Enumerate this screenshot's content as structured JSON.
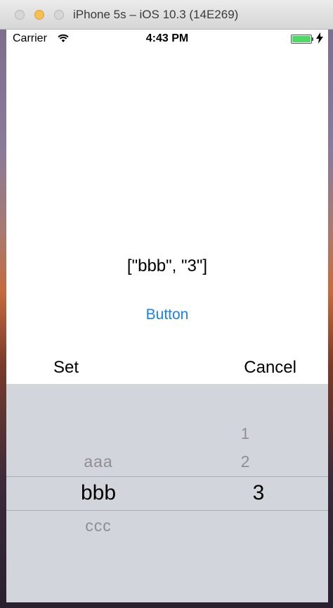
{
  "window": {
    "title": "iPhone 5s – iOS 10.3 (14E269)"
  },
  "status_bar": {
    "carrier": "Carrier",
    "time": "4:43 PM",
    "battery_color": "#4cd964"
  },
  "content": {
    "result_text": "[\"bbb\", \"3\"]",
    "button_label": "Button",
    "button_color": "#1a7ef5"
  },
  "toolbar": {
    "set_label": "Set",
    "cancel_label": "Cancel"
  },
  "picker": {
    "column1": {
      "above": "aaa",
      "selected": "bbb",
      "below": "ccc"
    },
    "column2": {
      "above2": "1",
      "above1": "2",
      "selected": "3"
    }
  }
}
